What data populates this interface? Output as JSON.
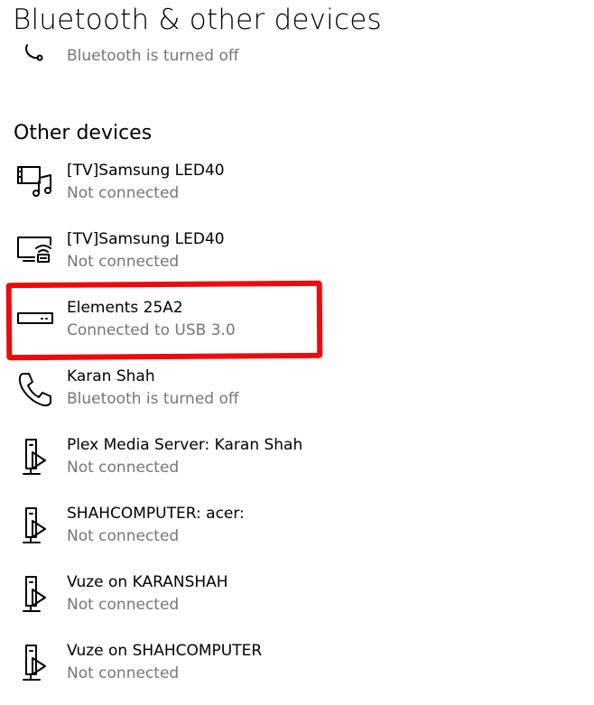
{
  "page": {
    "title": "Bluetooth & other devices",
    "top_partial_status": "Bluetooth is turned off"
  },
  "section": {
    "heading": "Other devices"
  },
  "devices": [
    {
      "name": "[TV]Samsung LED40",
      "status": "Not connected",
      "icon": "media-device-icon"
    },
    {
      "name": "[TV]Samsung LED40",
      "status": "Not connected",
      "icon": "wireless-display-icon"
    },
    {
      "name": "Elements 25A2",
      "status": "Connected to USB 3.0",
      "icon": "drive-icon"
    },
    {
      "name": "Karan Shah",
      "status": "Bluetooth is turned off",
      "icon": "phone-icon"
    },
    {
      "name": "Plex Media Server: Karan Shah",
      "status": "Not connected",
      "icon": "media-server-icon"
    },
    {
      "name": "SHAHCOMPUTER: acer:",
      "status": "Not connected",
      "icon": "media-server-icon"
    },
    {
      "name": "Vuze on KARANSHAH",
      "status": "Not connected",
      "icon": "media-server-icon"
    },
    {
      "name": "Vuze on SHAHCOMPUTER",
      "status": "Not connected",
      "icon": "media-server-icon"
    }
  ],
  "annotation": {
    "highlight_color": "#ee0a0a",
    "highlighted_device": "Elements 25A2"
  }
}
